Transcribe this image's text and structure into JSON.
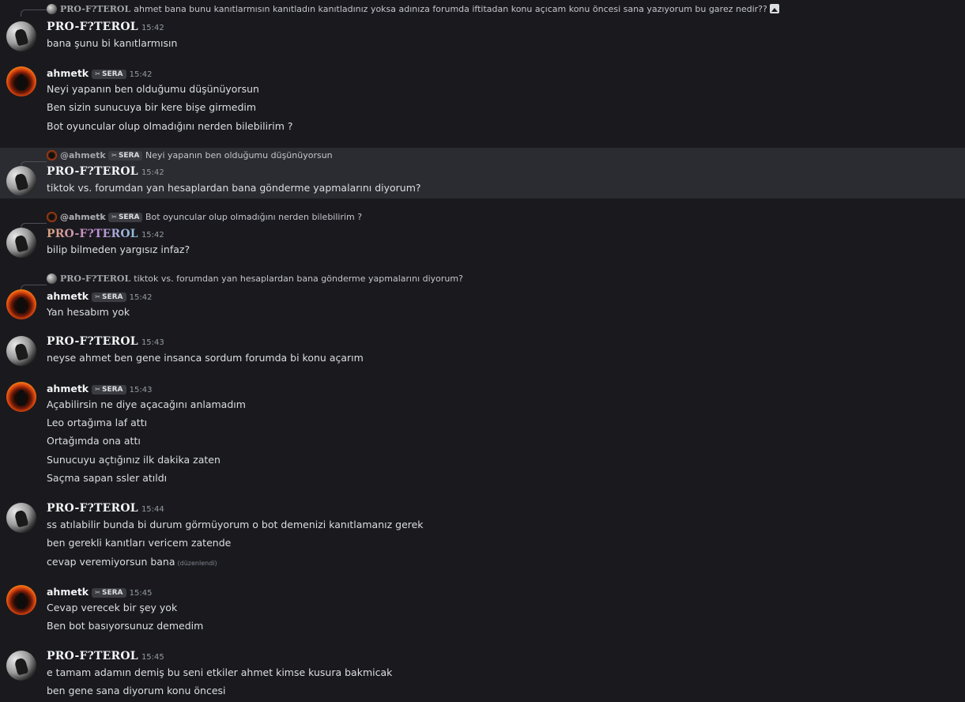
{
  "users": {
    "pro": "PRO-F?TEROL",
    "ahmet": "ahmetk",
    "ahmet_mention": "@ahmetk",
    "tag": "SERA",
    "tag_icon": "✂"
  },
  "messages": [
    {
      "reply": {
        "author": "PRO-F?TEROL",
        "text": "ahmet bana bunu kanıtlarmısın kanıtladın kanıtladınız yoksa adınıza forumda iftitadan konu açıcam konu öncesi sana yazıyorum bu garez nedir??"
      },
      "time": "15:42",
      "lines": [
        "bana şunu bi kanıtlarmısın"
      ]
    },
    {
      "time": "15:42",
      "lines": [
        "Neyi yapanın ben olduğumu düşünüyorsun",
        "Ben sizin sunucuya bir kere bişe girmedim",
        "Bot oyuncular olup olmadığını nerden bilebilirim ?"
      ]
    },
    {
      "reply": {
        "text": "Neyi yapanın ben olduğumu düşünüyorsun"
      },
      "time": "15:42",
      "lines": [
        "tiktok vs. forumdan yan hesaplardan bana gönderme yapmalarını diyorum?"
      ]
    },
    {
      "reply": {
        "text": "Bot oyuncular olup olmadığını nerden bilebilirim ?"
      },
      "time": "15:42",
      "lines": [
        "bilip bilmeden yargısız infaz?"
      ]
    },
    {
      "reply": {
        "text": "tiktok vs. forumdan yan hesaplardan bana gönderme yapmalarını diyorum?"
      },
      "time": "15:42",
      "lines": [
        "Yan hesabım yok"
      ]
    },
    {
      "time": "15:43",
      "lines": [
        "neyse ahmet ben gene insanca sordum forumda bi konu açarım"
      ]
    },
    {
      "time": "15:43",
      "lines": [
        "Açabilirsin ne diye açacağını anlamadım",
        "Leo ortağıma laf attı",
        "Ortağımda ona attı",
        "Sunucuyu açtığınız ilk dakika zaten",
        "Saçma sapan ssler atıldı"
      ]
    },
    {
      "time": "15:44",
      "lines": [
        "ss atılabilir bunda bi durum görmüyorum o bot demenizi kanıtlamanız gerek",
        "ben gerekli kanıtları vericem zatende",
        "cevap veremiyorsun bana"
      ],
      "edited": "(düzenlendi)"
    },
    {
      "time": "15:45",
      "lines": [
        "Cevap verecek bir şey yok",
        "Ben bot basıyorsunuz demedim"
      ]
    },
    {
      "time": "15:45",
      "lines": [
        "e tamam adamın demiş bu seni etkiler ahmet kimse kusura bakmicak",
        "ben gene sana diyorum konu öncesi"
      ]
    }
  ]
}
